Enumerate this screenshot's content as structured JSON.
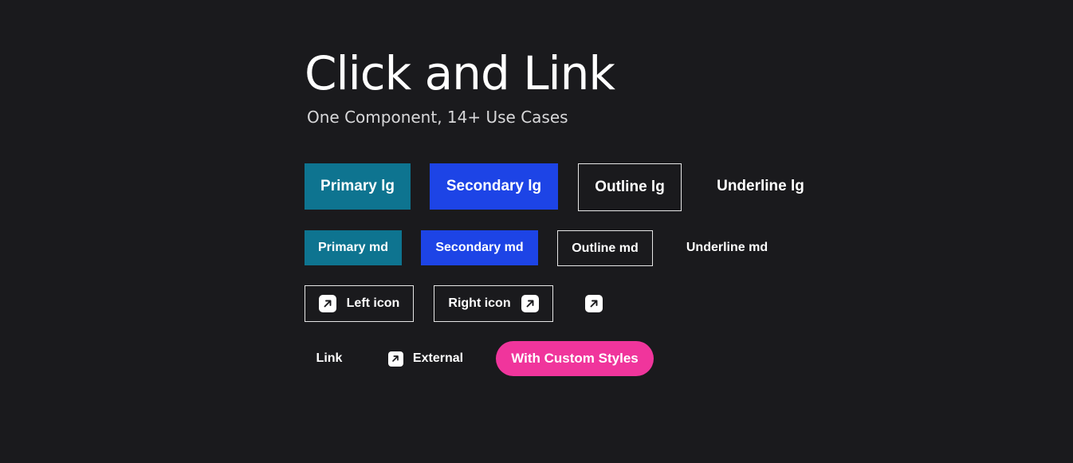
{
  "header": {
    "title": "Click and Link",
    "subtitle": "One Component, 14+ Use Cases"
  },
  "rows": {
    "large": {
      "primary": "Primary lg",
      "secondary": "Secondary lg",
      "outline": "Outline lg",
      "underline": "Underline lg"
    },
    "medium": {
      "primary": "Primary md",
      "secondary": "Secondary md",
      "outline": "Outline md",
      "underline": "Underline md"
    },
    "icons": {
      "left_icon": "Left icon",
      "right_icon": "Right icon",
      "icon_name": "arrow-up-right-icon"
    },
    "links": {
      "link": "Link",
      "external": "External",
      "custom": "With Custom Styles"
    }
  },
  "colors": {
    "background": "#1a1a1d",
    "primary": "#0e7490",
    "secondary": "#1d44e6",
    "outline_border": "#e6e6e6",
    "custom_pink": "#f0359c",
    "text": "#ffffff"
  }
}
